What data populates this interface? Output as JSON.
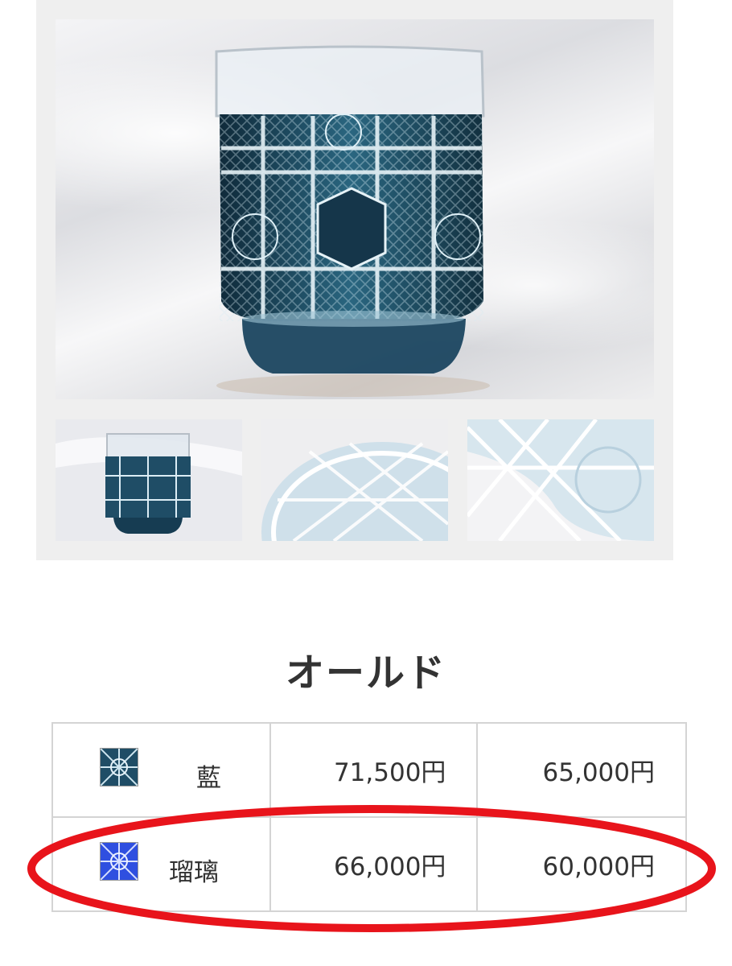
{
  "product": {
    "title": "オールド"
  },
  "gallery": {
    "main_image": "cut-glass-old-fashioned-tumbler-photo",
    "thumbnails": [
      "thumbnail-glass-front",
      "thumbnail-glass-bottom",
      "thumbnail-cut-pattern-closeup"
    ]
  },
  "price_table": {
    "rows": [
      {
        "swatch": "ai-color-swatch",
        "name": "藍",
        "price_1": "71,500円",
        "price_2": "65,000円"
      },
      {
        "swatch": "ruri-color-swatch",
        "name": "瑠璃",
        "price_1": "66,000円",
        "price_2": "60,000円"
      }
    ]
  },
  "annotation": {
    "highlighted_row": 1,
    "color": "#e8141b"
  },
  "colors": {
    "ai": "#1f4d66",
    "ruri": "#2f4fe0",
    "border": "#d4d4d4",
    "text": "#333333"
  }
}
